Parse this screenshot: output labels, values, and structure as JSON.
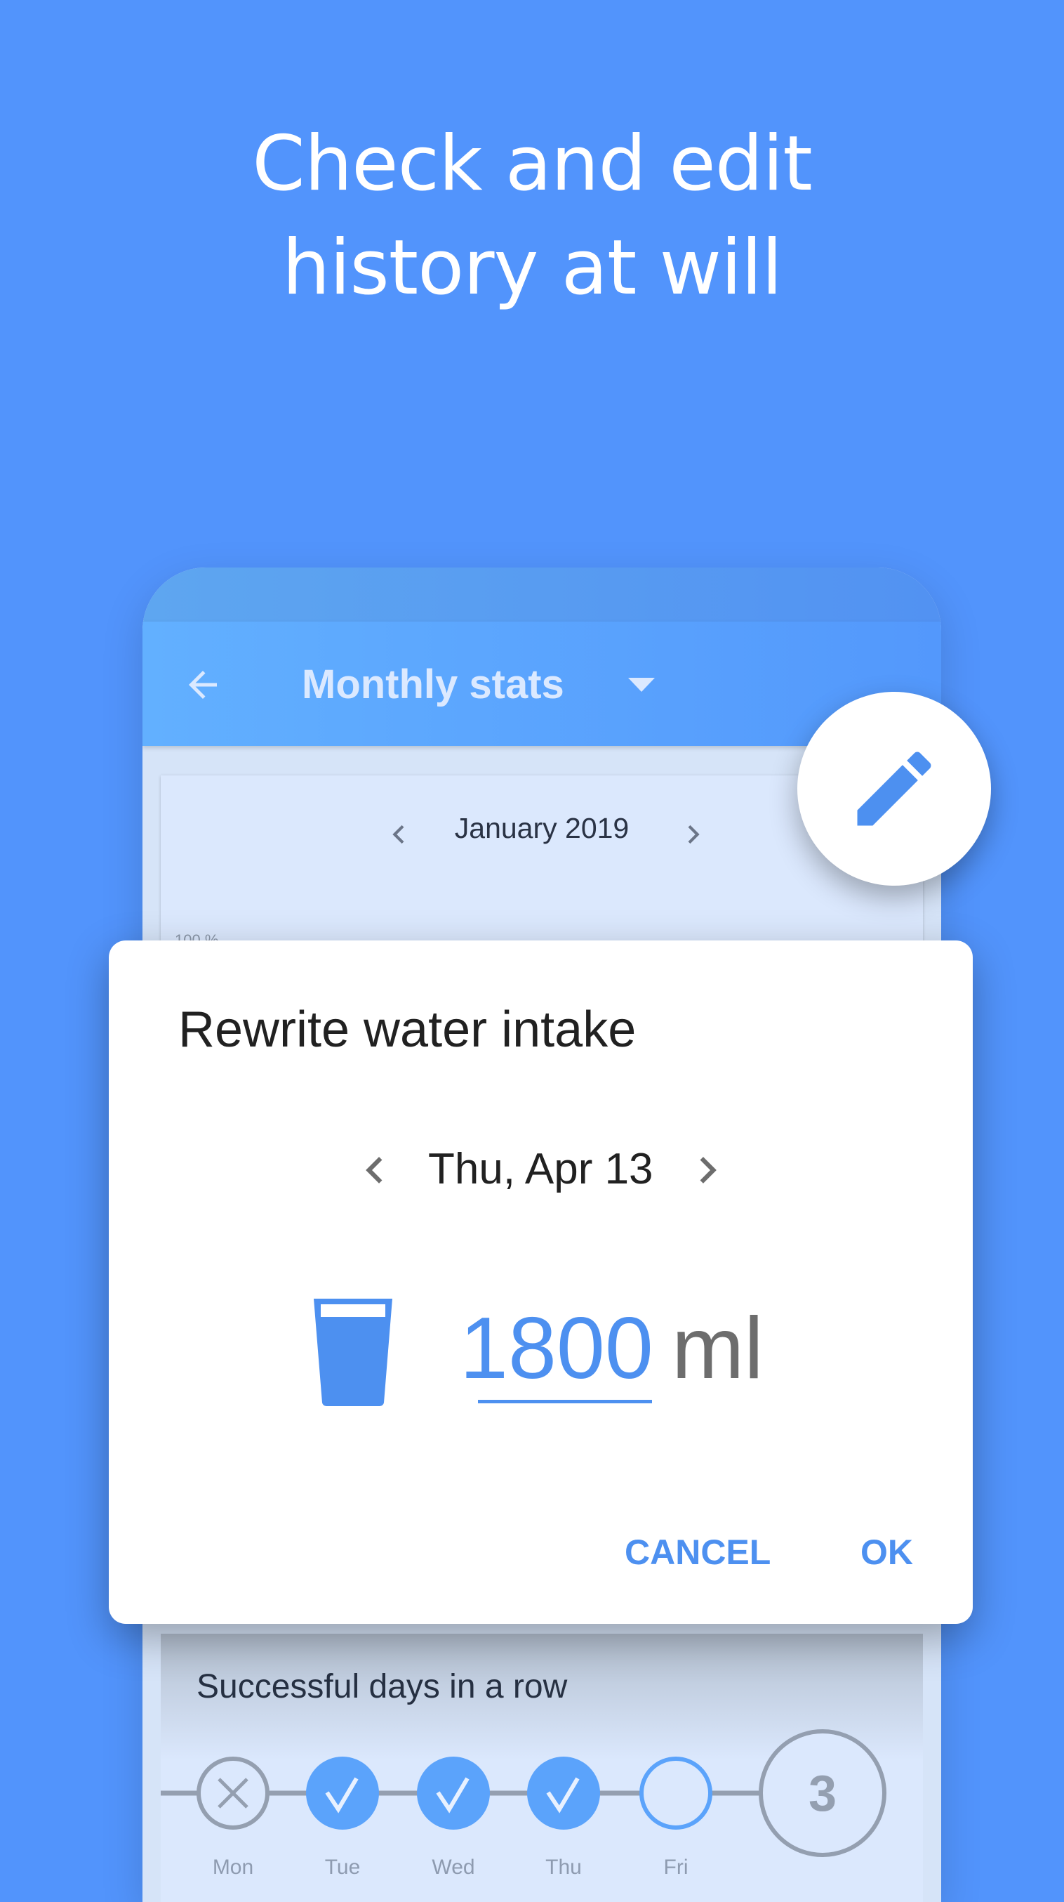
{
  "headline": {
    "line1": "Check and edit",
    "line2": "history at will"
  },
  "app_bar": {
    "title": "Monthly stats",
    "back_icon": "arrow-left-icon",
    "dropdown_icon": "caret-down-icon"
  },
  "stats_card": {
    "month": "January 2019",
    "y_axis_label": "100 %"
  },
  "fab": {
    "icon": "pencil-icon"
  },
  "dialog": {
    "title": "Rewrite water intake",
    "date": "Thu, Apr 13",
    "amount": "1800",
    "unit": "ml",
    "cancel_label": "CANCEL",
    "ok_label": "OK",
    "glass_icon": "water-glass-icon"
  },
  "streak_card": {
    "title": "Successful days in a row",
    "days": [
      {
        "label": "Mon",
        "status": "failed"
      },
      {
        "label": "Tue",
        "status": "success"
      },
      {
        "label": "Wed",
        "status": "success"
      },
      {
        "label": "Thu",
        "status": "success"
      },
      {
        "label": "Fri",
        "status": "pending"
      }
    ],
    "count": "3"
  },
  "colors": {
    "background": "#5294fc",
    "accent": "#4d90f0",
    "success": "#5ba3fb",
    "neutral": "#8e9bb0"
  }
}
